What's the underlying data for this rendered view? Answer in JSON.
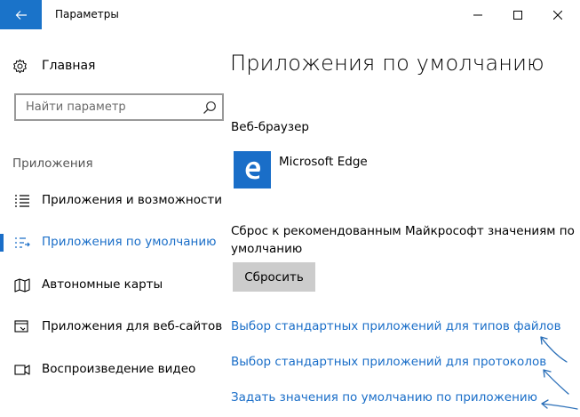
{
  "window": {
    "title": "Параметры"
  },
  "sidebar": {
    "home_label": "Главная",
    "search": {
      "placeholder": "Найти параметр",
      "value": ""
    },
    "section_title": "Приложения",
    "items": [
      {
        "label": "Приложения и возможности",
        "icon": "list-icon",
        "active": false
      },
      {
        "label": "Приложения по умолчанию",
        "icon": "default-apps-icon",
        "active": true
      },
      {
        "label": "Автономные карты",
        "icon": "map-icon",
        "active": false
      },
      {
        "label": "Приложения для веб-сайтов",
        "icon": "website-app-icon",
        "active": false
      },
      {
        "label": "Воспроизведение видео",
        "icon": "video-icon",
        "active": false
      }
    ]
  },
  "main": {
    "title": "Приложения по умолчанию",
    "browser_heading": "Веб-браузер",
    "browser_app": "Microsoft Edge",
    "reset_text": "Сброс к рекомендованным Майкрософт значениям по умолчанию",
    "reset_button": "Сбросить",
    "links": [
      "Выбор стандартных приложений для типов файлов",
      "Выбор стандартных приложений для протоколов",
      "Задать значения по умолчанию по приложению"
    ]
  },
  "colors": {
    "accent": "#1a6ec8",
    "back_button": "#1a73c9",
    "reset_button_bg": "#cccccc"
  }
}
